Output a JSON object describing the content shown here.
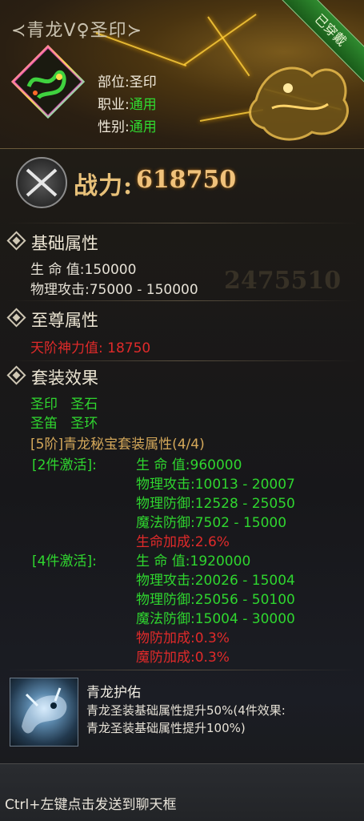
{
  "header": {
    "title": "≺青龙Ⅴ♀圣印≻",
    "worn_badge": "已穿戴",
    "slot_label": "部位:",
    "slot_value": "圣印",
    "job_label": "职业:",
    "job_value": "通用",
    "gender_label": "性别:",
    "gender_value": "通用"
  },
  "power": {
    "label": "战力:",
    "value": "618750",
    "watermark": "2475510"
  },
  "basic": {
    "title": "基础属性",
    "hp_label": "生 命 值:",
    "hp_value": "150000",
    "atk_label": "物理攻击:",
    "atk_value": "75000 - 150000"
  },
  "supreme": {
    "title": "至尊属性",
    "line": "天阶神力值: 18750"
  },
  "set": {
    "title": "套装效果",
    "pieces_row1": "圣印   圣石",
    "pieces_row2": "圣笛   圣环",
    "set_name": "[5阶]青龙秘宝套装属性(4/4)",
    "tier2": {
      "label": "[2件激活]:",
      "stats": [
        {
          "name": "生 命 值:",
          "value": "960000",
          "color": "g"
        },
        {
          "name": "物理攻击:",
          "value": "10013 - 20007",
          "color": "g"
        },
        {
          "name": "物理防御:",
          "value": "12528 - 25050",
          "color": "g"
        },
        {
          "name": "魔法防御:",
          "value": "7502 - 15000",
          "color": "g"
        },
        {
          "name": "生命加成:",
          "value": "2.6%",
          "color": "r"
        }
      ]
    },
    "tier4": {
      "label": "[4件激活]:",
      "stats": [
        {
          "name": "生 命 值:",
          "value": "1920000",
          "color": "g"
        },
        {
          "name": "物理攻击:",
          "value": "20026 - 15004",
          "color": "g"
        },
        {
          "name": "物理防御:",
          "value": "25056 - 50100",
          "color": "g"
        },
        {
          "name": "魔法防御:",
          "value": "15004 - 30000",
          "color": "g"
        },
        {
          "name": "物防加成:",
          "value": "0.3%",
          "color": "r"
        },
        {
          "name": "魔防加成:",
          "value": "0.3%",
          "color": "r"
        }
      ]
    }
  },
  "skill": {
    "name": "青龙护佑",
    "desc_line1": "青龙圣装基础属性提升50%(4件效果:",
    "desc_line2": "青龙圣装基础属性提升100%)"
  },
  "footer": {
    "hint": "Ctrl+左键点击发送到聊天框"
  },
  "colors": {
    "green": "#2fd62f",
    "red": "#e02a2a",
    "gold": "#d4a85a",
    "power_gold": "#f0c27b"
  },
  "icons": [
    "dragon-item-icon",
    "crossed-swords-icon",
    "diamond-bullet-icon",
    "azure-dragon-skill-icon"
  ]
}
